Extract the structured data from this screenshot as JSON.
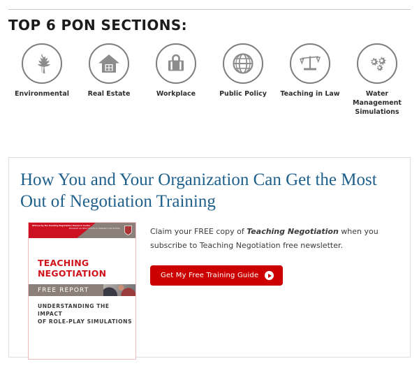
{
  "sections": {
    "title": "TOP 6 PON SECTIONS:",
    "items": [
      {
        "label": "Environmental",
        "icon": "leaf-icon"
      },
      {
        "label": "Real Estate",
        "icon": "house-icon"
      },
      {
        "label": "Workplace",
        "icon": "briefcase-icon"
      },
      {
        "label": "Public Policy",
        "icon": "globe-icon"
      },
      {
        "label": "Teaching in Law",
        "icon": "scales-icon"
      },
      {
        "label": "Water Management Simulations",
        "icon": "gears-icon"
      }
    ],
    "icon_color": "#7d7d7d",
    "divider_color": "#c9c9c9"
  },
  "promo": {
    "title": "How You and Your Organization Can Get the Most Out of Negotiation Training",
    "title_color": "#1f5f8b",
    "claim_prefix": "Claim your FREE copy of ",
    "claim_emphasis": "Teaching Negotiation",
    "claim_suffix": " when you subscribe to Teaching Negotiation free newsletter.",
    "cta_label": "Get My Free Training Guide",
    "cta_color": "#cc0000",
    "cta_icon": "play-circle-icon",
    "book": {
      "banner_red_text": "Offered by the Teaching Negotiation Resource Center",
      "banner_gray_text": "PROGRAM ON NEGOTIATION AT HARVARD LAW SCHOOL",
      "shield_icon": "harvard-shield-icon",
      "title_line1": "TEACHING",
      "title_line2": "NEGOTIATION",
      "free_report_label": "FREE REPORT",
      "subtitle_line1": "UNDERSTANDING THE IMPACT",
      "subtitle_line2": "OF ROLE-PLAY SIMULATIONS",
      "title_color": "#d0121b",
      "band_color": "#8a8079"
    }
  }
}
